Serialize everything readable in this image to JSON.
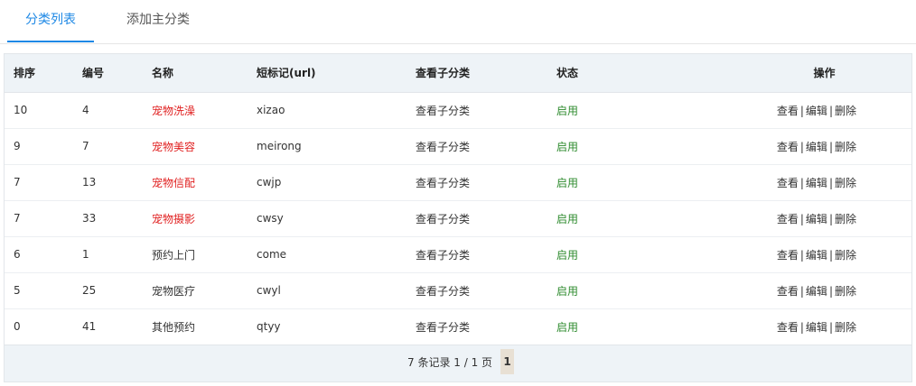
{
  "tabs": [
    {
      "label": "分类列表"
    },
    {
      "label": "添加主分类"
    }
  ],
  "table": {
    "headers": [
      "排序",
      "编号",
      "名称",
      "短标记(url)",
      "查看子分类",
      "状态",
      "操作"
    ],
    "rows": [
      {
        "sort": "10",
        "id": "4",
        "name": "宠物洗澡",
        "slug": "xizao",
        "view_sub": "查看子分类",
        "status": "启用"
      },
      {
        "sort": "9",
        "id": "7",
        "name": "宠物美容",
        "slug": "meirong",
        "view_sub": "查看子分类",
        "status": "启用"
      },
      {
        "sort": "7",
        "id": "13",
        "name": "宠物信配",
        "slug": "cwjp",
        "view_sub": "查看子分类",
        "status": "启用"
      },
      {
        "sort": "7",
        "id": "33",
        "name": "宠物摄影",
        "slug": "cwsy",
        "view_sub": "查看子分类",
        "status": "启用"
      },
      {
        "sort": "6",
        "id": "1",
        "name": "预约上门",
        "slug": "come",
        "view_sub": "查看子分类",
        "status": "启用"
      },
      {
        "sort": "5",
        "id": "25",
        "name": "宠物医疗",
        "slug": "cwyl",
        "view_sub": "查看子分类",
        "status": "启用"
      },
      {
        "sort": "0",
        "id": "41",
        "name": "其他预约",
        "slug": "qtyy",
        "view_sub": "查看子分类",
        "status": "启用"
      }
    ],
    "actions": {
      "view": "查看",
      "edit": "编辑",
      "delete": "删除",
      "separator": "|"
    }
  },
  "pagination": {
    "summary": "7 条记录 1 / 1 页",
    "current_page": "1"
  },
  "colors": {
    "accent": "#1e88e5",
    "name_highlight": "#e02020",
    "status_enabled": "#2e8b2e"
  }
}
